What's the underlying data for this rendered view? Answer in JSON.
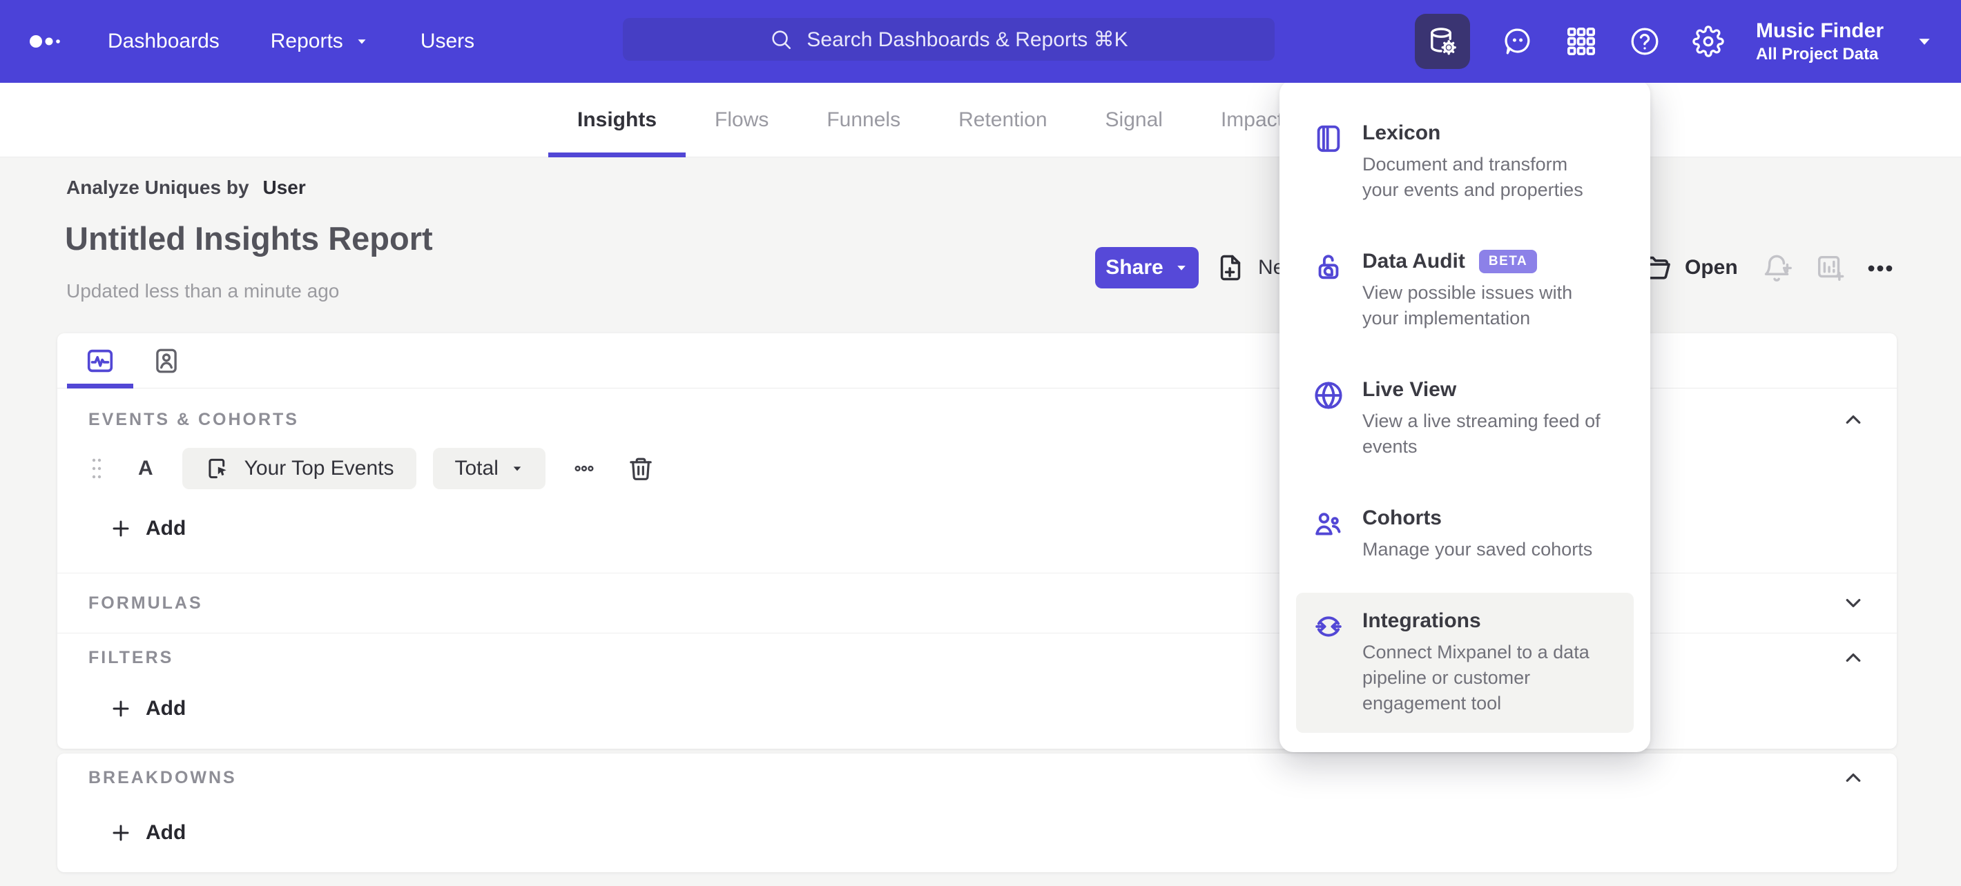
{
  "topnav": {
    "items": [
      {
        "label": "Dashboards"
      },
      {
        "label": "Reports"
      },
      {
        "label": "Users"
      }
    ],
    "search": {
      "placeholder": "Search Dashboards & Reports ⌘K"
    },
    "project": {
      "name": "Music Finder",
      "subtitle": "All Project Data"
    }
  },
  "tabs": {
    "items": [
      {
        "label": "Insights",
        "active": true
      },
      {
        "label": "Flows"
      },
      {
        "label": "Funnels"
      },
      {
        "label": "Retention"
      },
      {
        "label": "Signal"
      },
      {
        "label": "Impact"
      }
    ]
  },
  "report": {
    "analyze_prefix": "Analyze Uniques by",
    "analyze_entity": "User",
    "title": "Untitled Insights Report",
    "updated": "Updated less than a minute ago"
  },
  "actions": {
    "share": "Share",
    "new": "New",
    "open": "Open"
  },
  "builder": {
    "events": {
      "label": "EVENTS & COHORTS",
      "row": {
        "letter": "A",
        "event": "Your Top Events",
        "metric": "Total"
      },
      "add": "Add"
    },
    "formulas": {
      "label": "FORMULAS"
    },
    "filters": {
      "label": "FILTERS",
      "add": "Add"
    },
    "breakdowns": {
      "label": "BREAKDOWNS",
      "add": "Add"
    }
  },
  "menu": {
    "items": [
      {
        "icon": "lexicon-book-icon",
        "title": "Lexicon",
        "desc": "Document and transform your events and properties"
      },
      {
        "icon": "data-audit-lock-icon",
        "title": "Data Audit",
        "badge": "BETA",
        "desc": "View possible issues with your implementation"
      },
      {
        "icon": "live-view-globe-icon",
        "title": "Live View",
        "desc": "View a live streaming feed of events"
      },
      {
        "icon": "cohorts-users-icon",
        "title": "Cohorts",
        "desc": "Manage your saved cohorts"
      },
      {
        "icon": "integrations-sync-icon",
        "title": "Integrations",
        "desc": "Connect Mixpanel to a data pipeline or customer engagement tool",
        "active": true
      }
    ]
  },
  "colors": {
    "brand_purple": "#4B42D8",
    "accent_purple": "#5247D5",
    "search_bg": "#463EC4",
    "active_nav_icon_bg": "#3A3472",
    "beta_badge_bg": "#8C81E8",
    "page_bg": "#F5F5F4",
    "disabled_icon": "#C3C3C8"
  }
}
